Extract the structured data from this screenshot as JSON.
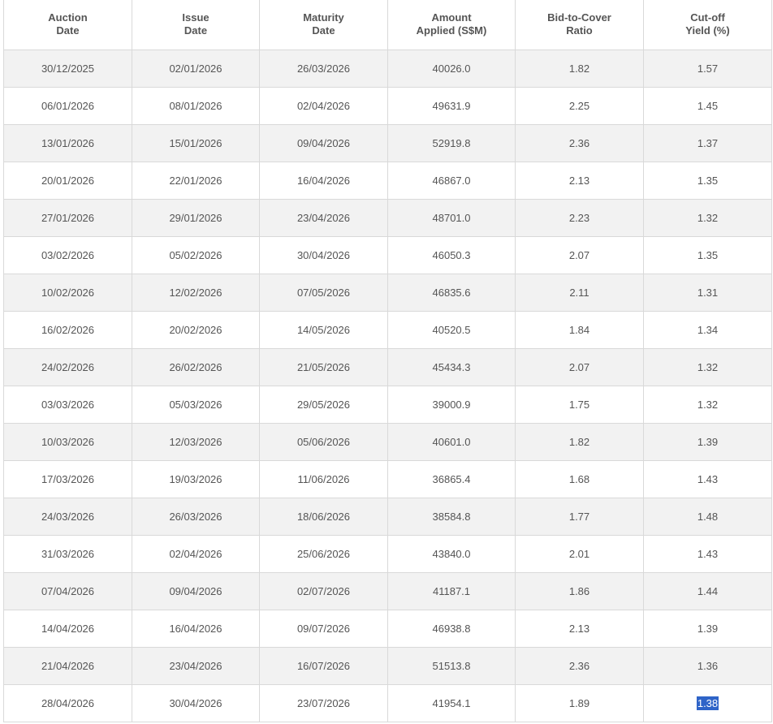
{
  "columns": [
    {
      "line1": "Auction",
      "line2": "Date"
    },
    {
      "line1": "Issue",
      "line2": "Date"
    },
    {
      "line1": "Maturity",
      "line2": "Date"
    },
    {
      "line1": "Amount",
      "line2": "Applied (S$M)"
    },
    {
      "line1": "Bid-to-Cover",
      "line2": "Ratio"
    },
    {
      "line1": "Cut-off",
      "line2": "Yield (%)"
    }
  ],
  "rows": [
    [
      "30/12/2025",
      "02/01/2026",
      "26/03/2026",
      "40026.0",
      "1.82",
      "1.57"
    ],
    [
      "06/01/2026",
      "08/01/2026",
      "02/04/2026",
      "49631.9",
      "2.25",
      "1.45"
    ],
    [
      "13/01/2026",
      "15/01/2026",
      "09/04/2026",
      "52919.8",
      "2.36",
      "1.37"
    ],
    [
      "20/01/2026",
      "22/01/2026",
      "16/04/2026",
      "46867.0",
      "2.13",
      "1.35"
    ],
    [
      "27/01/2026",
      "29/01/2026",
      "23/04/2026",
      "48701.0",
      "2.23",
      "1.32"
    ],
    [
      "03/02/2026",
      "05/02/2026",
      "30/04/2026",
      "46050.3",
      "2.07",
      "1.35"
    ],
    [
      "10/02/2026",
      "12/02/2026",
      "07/05/2026",
      "46835.6",
      "2.11",
      "1.31"
    ],
    [
      "16/02/2026",
      "20/02/2026",
      "14/05/2026",
      "40520.5",
      "1.84",
      "1.34"
    ],
    [
      "24/02/2026",
      "26/02/2026",
      "21/05/2026",
      "45434.3",
      "2.07",
      "1.32"
    ],
    [
      "03/03/2026",
      "05/03/2026",
      "29/05/2026",
      "39000.9",
      "1.75",
      "1.32"
    ],
    [
      "10/03/2026",
      "12/03/2026",
      "05/06/2026",
      "40601.0",
      "1.82",
      "1.39"
    ],
    [
      "17/03/2026",
      "19/03/2026",
      "11/06/2026",
      "36865.4",
      "1.68",
      "1.43"
    ],
    [
      "24/03/2026",
      "26/03/2026",
      "18/06/2026",
      "38584.8",
      "1.77",
      "1.48"
    ],
    [
      "31/03/2026",
      "02/04/2026",
      "25/06/2026",
      "43840.0",
      "2.01",
      "1.43"
    ],
    [
      "07/04/2026",
      "09/04/2026",
      "02/07/2026",
      "41187.1",
      "1.86",
      "1.44"
    ],
    [
      "14/04/2026",
      "16/04/2026",
      "09/07/2026",
      "46938.8",
      "2.13",
      "1.39"
    ],
    [
      "21/04/2026",
      "23/04/2026",
      "16/07/2026",
      "51513.8",
      "2.36",
      "1.36"
    ],
    [
      "28/04/2026",
      "30/04/2026",
      "23/07/2026",
      "41954.1",
      "1.89",
      "1.38"
    ]
  ],
  "selection": {
    "row": 17,
    "col": 5,
    "highlight_color": "#2f64c8"
  },
  "colors": {
    "stripe": "#f2f2f2",
    "border": "#d9d9d9",
    "text": "#555555"
  }
}
